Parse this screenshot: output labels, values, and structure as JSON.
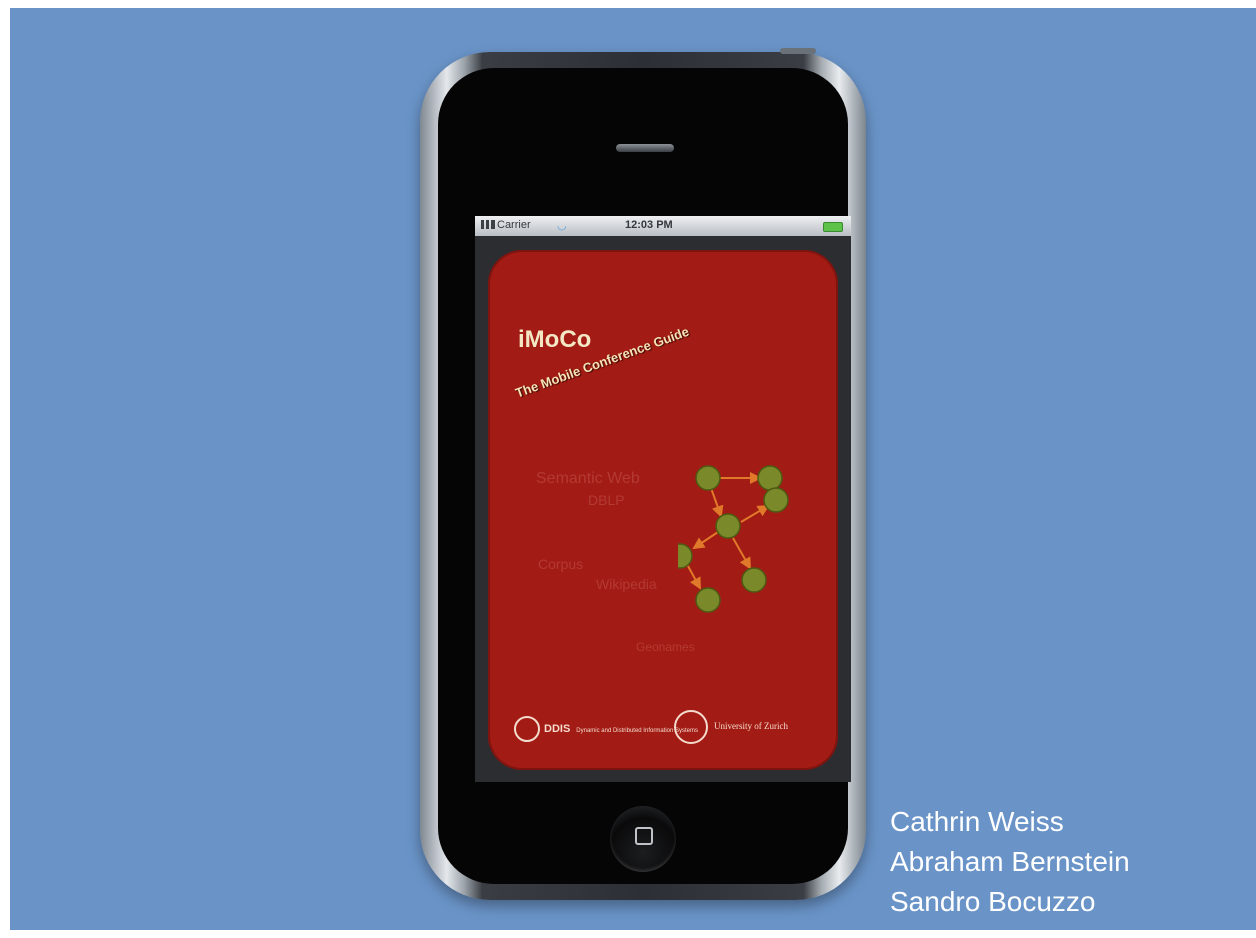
{
  "status_bar": {
    "carrier": "Carrier",
    "time": "12:03 PM"
  },
  "splash": {
    "app_title": "iMoCo",
    "tagline": "The Mobile Conference Guide",
    "keywords": [
      "Semantic Web",
      "DBLP",
      "Corpus",
      "Wikipedia",
      "Geonames"
    ],
    "footer_left_name": "DDIS",
    "footer_left_small": "Dynamic and Distributed Information Systems",
    "footer_right": "University of Zurich"
  },
  "credits": [
    "Cathrin Weiss",
    "Abraham Bernstein",
    "Sandro Bocuzzo"
  ],
  "colors": {
    "background": "#6a94c8",
    "splash_red": "#a21b14",
    "node_green": "#7a8a2a",
    "arrow_orange": "#e07a2a"
  },
  "icons": [
    "signal-icon",
    "wifi-icon",
    "battery-icon",
    "graph-network-icon",
    "university-seal-icon",
    "home-button-icon"
  ]
}
